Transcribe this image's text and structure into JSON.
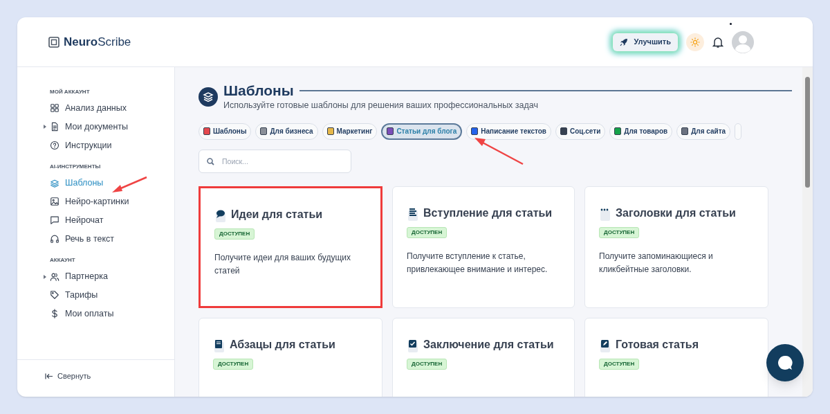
{
  "brand": {
    "bold": "Neuro",
    "rest": "Scribe"
  },
  "header": {
    "upgrade_button": "Улучшить",
    "notification_dot": true
  },
  "sidebar": {
    "sections": [
      {
        "title": "МОЙ АККАУНТ",
        "items": [
          {
            "label": "Анализ данных",
            "expandable": false,
            "selected": false
          },
          {
            "label": "Мои документы",
            "expandable": true,
            "selected": false
          },
          {
            "label": "Инструкции",
            "expandable": false,
            "selected": false
          }
        ]
      },
      {
        "title": "AI-ИНСТРУМЕНТЫ",
        "items": [
          {
            "label": "Шаблоны",
            "expandable": false,
            "selected": true
          },
          {
            "label": "Нейро-картинки",
            "expandable": false,
            "selected": false
          },
          {
            "label": "Нейрочат",
            "expandable": false,
            "selected": false
          },
          {
            "label": "Речь в текст",
            "expandable": false,
            "selected": false
          }
        ]
      },
      {
        "title": "АККАУНТ",
        "items": [
          {
            "label": "Партнерка",
            "expandable": true,
            "selected": false
          },
          {
            "label": "Тарифы",
            "expandable": false,
            "selected": false
          },
          {
            "label": "Мои оплаты",
            "expandable": false,
            "selected": false
          }
        ]
      }
    ],
    "collapse": "Свернуть"
  },
  "page": {
    "title": "Шаблоны",
    "subtitle": "Используйте готовые шаблоны для решения ваших профессиональных задач"
  },
  "categories": [
    {
      "label": "Шаблоны",
      "selected": false,
      "color": "#e5484d"
    },
    {
      "label": "Для бизнеса",
      "selected": false,
      "color": "#8a8f98"
    },
    {
      "label": "Маркетинг",
      "selected": false,
      "color": "#e6b84a"
    },
    {
      "label": "Статьи для блога",
      "selected": true,
      "color": "#7b4fb8"
    },
    {
      "label": "Написание текстов",
      "selected": false,
      "color": "#2563eb"
    },
    {
      "label": "Соц.сети",
      "selected": false,
      "color": "#374151"
    },
    {
      "label": "Для товаров",
      "selected": false,
      "color": "#16a34a"
    },
    {
      "label": "Для сайта",
      "selected": false,
      "color": "#6b7280"
    }
  ],
  "search": {
    "placeholder": "Поиск..."
  },
  "templates": [
    {
      "title": "Идеи для статьи",
      "badge": "ДОСТУПЕН",
      "description": "Получите идеи для ваших будущих статей",
      "highlighted": true
    },
    {
      "title": "Вступление для статьи",
      "badge": "ДОСТУПЕН",
      "description": "Получите вступление к статье, привлекающее внимание и интерес.",
      "highlighted": false
    },
    {
      "title": "Заголовки для статьи",
      "badge": "ДОСТУПЕН",
      "description": "Получите запоминающиеся и кликбейтные заголовки.",
      "highlighted": false
    },
    {
      "title": "Абзацы для статьи",
      "badge": "ДОСТУПЕН",
      "highlighted": false
    },
    {
      "title": "Заключение для статьи",
      "badge": "ДОСТУПЕН",
      "highlighted": false
    },
    {
      "title": "Готовая статья",
      "badge": "ДОСТУПЕН",
      "highlighted": false
    }
  ]
}
